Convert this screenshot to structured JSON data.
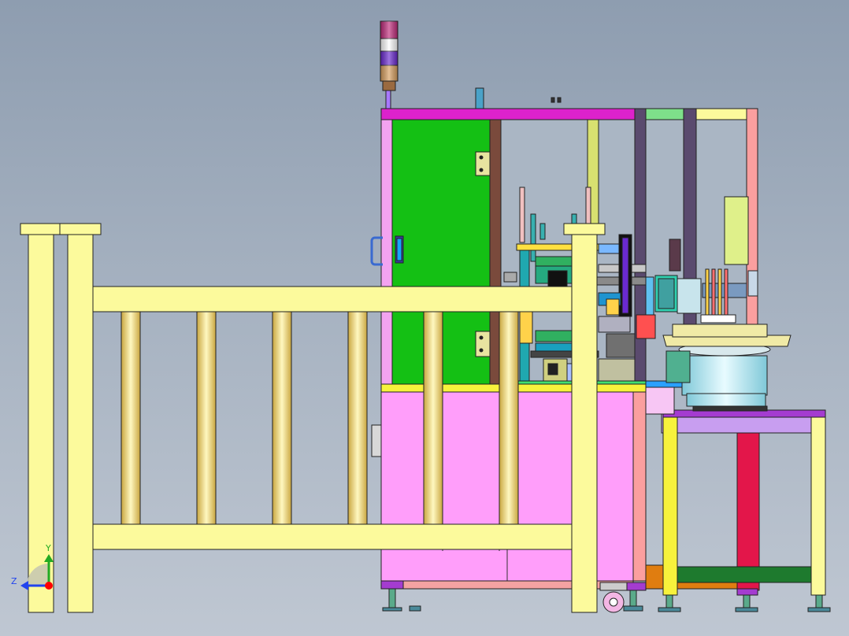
{
  "viewport": {
    "view_orientation": "front",
    "render_mode": "shaded-with-edges",
    "background_colors": [
      "#8e9db0",
      "#bfc7d2"
    ]
  },
  "model": {
    "components": [
      {
        "name": "safety-fence",
        "color": "#fcfa9c"
      },
      {
        "name": "fence-post",
        "color": "#fcfa9c"
      },
      {
        "name": "fence-bar",
        "color": "#e6d06a"
      },
      {
        "name": "main-cabinet-door",
        "color": "#14c014"
      },
      {
        "name": "lower-cabinet",
        "color": "#ff9efa"
      },
      {
        "name": "frame-top-beam",
        "color": "#dd22cc"
      },
      {
        "name": "side-frame-post",
        "color": "#f3a3f0"
      },
      {
        "name": "vertical-beam",
        "color": "#5a4a6e"
      },
      {
        "name": "vibratory-bowl-top",
        "color": "#f0eaa6"
      },
      {
        "name": "vibratory-bowl-body",
        "color": "#b5e6ec"
      },
      {
        "name": "feeder-table-top",
        "color": "#c89ef0"
      },
      {
        "name": "feeder-table-leg",
        "color": "#f7f23c"
      },
      {
        "name": "feeder-table-center-post",
        "color": "#e3164a"
      },
      {
        "name": "feeder-table-crossbar",
        "color": "#1e7a2e"
      },
      {
        "name": "signal-tower",
        "color": "#c02c7c"
      },
      {
        "name": "caster-wheel",
        "color": "#f3b6e4"
      },
      {
        "name": "leveling-foot",
        "color": "#5aaa8a"
      },
      {
        "name": "control-panel-box",
        "color": "#dff08a"
      }
    ],
    "signal_tower_colors": [
      "#c02c7c",
      "#ffffff",
      "#6a2ad0",
      "#d8a060"
    ]
  },
  "triad": {
    "labels": {
      "y": "Y",
      "z": "Z"
    },
    "colors": {
      "y": "#22aa22",
      "z": "#2244ee",
      "x": "#ff0000"
    }
  }
}
